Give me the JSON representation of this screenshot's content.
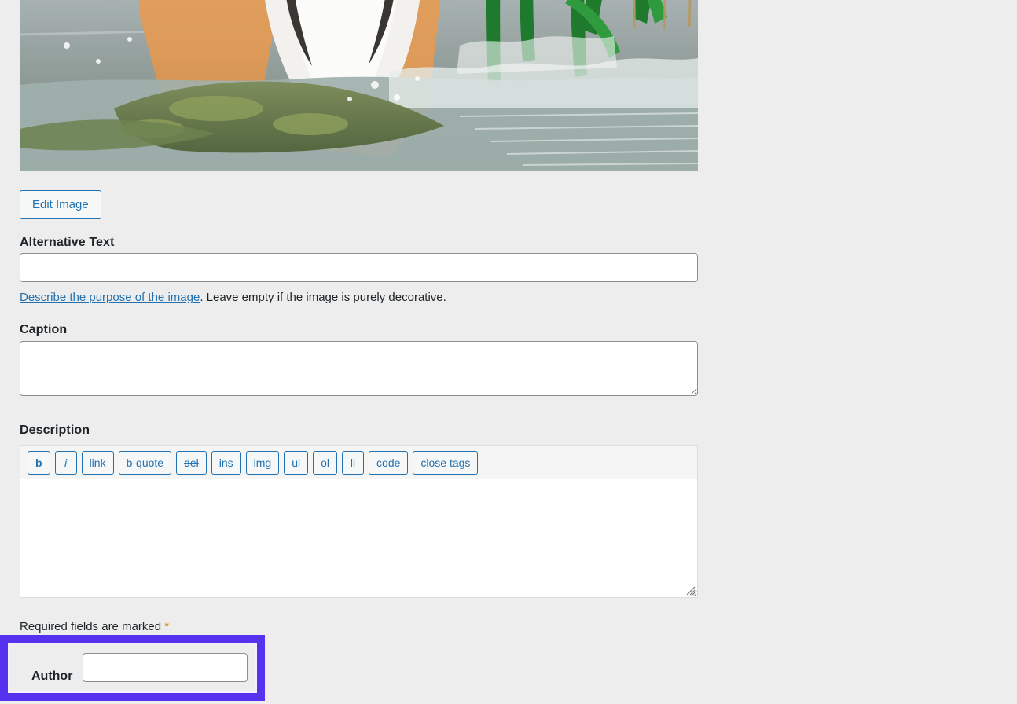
{
  "media_preview": {
    "name": "tiger-in-water-photo",
    "alt_description": "Close-up photo of a wet tiger wading through shallow water with green reeds",
    "edit_button_label": "Edit Image"
  },
  "fields": {
    "alternative_text": {
      "label": "Alternative Text",
      "value": "",
      "placeholder": "",
      "help_link_text": "Describe the purpose of the image",
      "help_rest_text": ". Leave empty if the image is purely decorative."
    },
    "caption": {
      "label": "Caption",
      "value": "",
      "placeholder": ""
    },
    "description": {
      "label": "Description",
      "value": "",
      "placeholder": "",
      "toolbar_buttons": [
        {
          "id": "b",
          "label": "b"
        },
        {
          "id": "i",
          "label": "i"
        },
        {
          "id": "link",
          "label": "link"
        },
        {
          "id": "b-quote",
          "label": "b-quote"
        },
        {
          "id": "del",
          "label": "del"
        },
        {
          "id": "ins",
          "label": "ins"
        },
        {
          "id": "img",
          "label": "img"
        },
        {
          "id": "ul",
          "label": "ul"
        },
        {
          "id": "ol",
          "label": "ol"
        },
        {
          "id": "li",
          "label": "li"
        },
        {
          "id": "code",
          "label": "code"
        },
        {
          "id": "close-tags",
          "label": "close tags"
        }
      ]
    },
    "author": {
      "label": "Author",
      "value": "",
      "placeholder": ""
    }
  },
  "required_note": {
    "text": "Required fields are marked ",
    "marker": "*"
  },
  "colors": {
    "background": "#ededed",
    "accent_link": "#2271b1",
    "highlight_outline": "#5533ee",
    "required_marker": "#d98500",
    "input_border": "#8c8f94",
    "text": "#1d2327"
  }
}
